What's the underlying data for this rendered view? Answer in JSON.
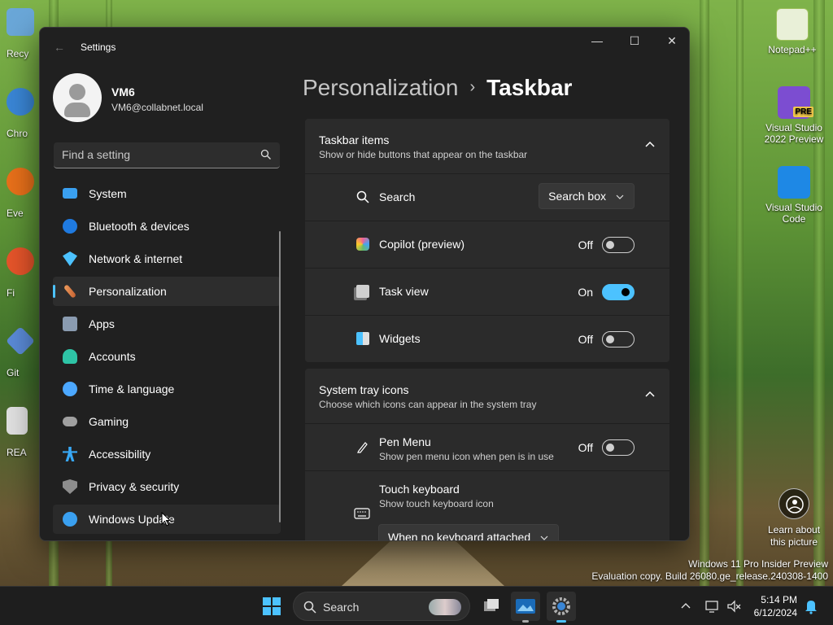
{
  "desktop": {
    "icons_right": [
      {
        "label": "Notepad++",
        "icon": "notepadpp-icon"
      },
      {
        "label": "Visual Studio 2022 Preview",
        "icon": "visual-studio-icon",
        "badge": "PRE"
      },
      {
        "label": "Visual Studio Code",
        "icon": "vscode-icon"
      }
    ],
    "icons_left_partial": [
      {
        "label": "Recy",
        "icon": "recycle-bin-icon"
      },
      {
        "label": "Chro",
        "icon": "chrome-icon"
      },
      {
        "label": "Eve",
        "icon": "everything-icon"
      },
      {
        "label": "Fi",
        "icon": "firefox-icon"
      },
      {
        "label": "Git",
        "icon": "git-icon"
      },
      {
        "label": "REA",
        "icon": "readme-icon"
      }
    ],
    "learn_about": "Learn about this picture",
    "watermark_line1": "Windows 11 Pro Insider Preview",
    "watermark_line2": "Evaluation copy. Build 26080.ge_release.240308-1400"
  },
  "window": {
    "title": "Settings",
    "controls": {
      "minimize": "—",
      "maximize": "☐",
      "close": "✕"
    }
  },
  "profile": {
    "name": "VM6",
    "email": "VM6@collabnet.local"
  },
  "search": {
    "placeholder": "Find a setting"
  },
  "sidebar": {
    "items": [
      {
        "label": "System",
        "icon": "system-icon",
        "color": "#3aa0f0"
      },
      {
        "label": "Bluetooth & devices",
        "icon": "bluetooth-icon",
        "color": "#1f7ae0"
      },
      {
        "label": "Network & internet",
        "icon": "wifi-icon",
        "color": "#4cc2ff"
      },
      {
        "label": "Personalization",
        "icon": "brush-icon",
        "color": "#e7935a"
      },
      {
        "label": "Apps",
        "icon": "apps-icon",
        "color": "#8a9bb0"
      },
      {
        "label": "Accounts",
        "icon": "accounts-icon",
        "color": "#2ec4a6"
      },
      {
        "label": "Time & language",
        "icon": "globe-clock-icon",
        "color": "#4ca8ff"
      },
      {
        "label": "Gaming",
        "icon": "controller-icon",
        "color": "#a0a0a0"
      },
      {
        "label": "Accessibility",
        "icon": "accessibility-icon",
        "color": "#38a8f5"
      },
      {
        "label": "Privacy & security",
        "icon": "shield-icon",
        "color": "#8d8d8d"
      },
      {
        "label": "Windows Update",
        "icon": "update-icon",
        "color": "#3aa0f0"
      }
    ],
    "active_index": 3
  },
  "breadcrumb": {
    "parent": "Personalization",
    "separator": "›",
    "current": "Taskbar"
  },
  "taskbar_items": {
    "title": "Taskbar items",
    "subtitle": "Show or hide buttons that appear on the taskbar",
    "rows": [
      {
        "label": "Search",
        "icon": "search-icon",
        "control": "dropdown",
        "value": "Search box"
      },
      {
        "label": "Copilot (preview)",
        "icon": "copilot-icon",
        "control": "toggle",
        "state": "Off",
        "on": false
      },
      {
        "label": "Task view",
        "icon": "task-view-icon",
        "control": "toggle",
        "state": "On",
        "on": true
      },
      {
        "label": "Widgets",
        "icon": "widgets-icon",
        "control": "toggle",
        "state": "Off",
        "on": false
      }
    ]
  },
  "system_tray": {
    "title": "System tray icons",
    "subtitle": "Choose which icons can appear in the system tray",
    "pen_menu": {
      "label": "Pen Menu",
      "sub": "Show pen menu icon when pen is in use",
      "state": "Off",
      "on": false
    },
    "touch_keyboard": {
      "label": "Touch keyboard",
      "sub": "Show touch keyboard icon",
      "value": "When no keyboard attached"
    }
  },
  "taskbar": {
    "search_label": "Search",
    "time": "5:14 PM",
    "date": "6/12/2024"
  }
}
